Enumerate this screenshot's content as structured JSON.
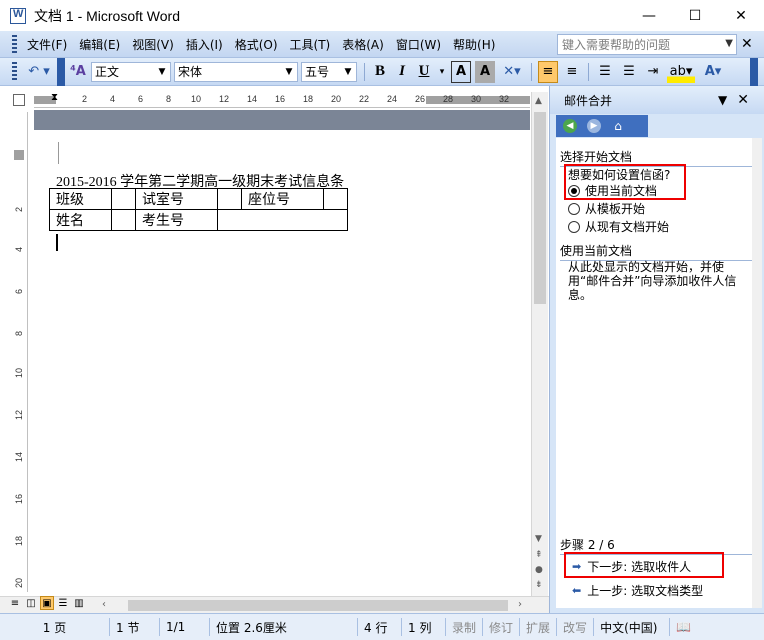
{
  "window": {
    "title": "文档 1 - Microsoft Word",
    "minimize": "—",
    "maximize": "☐",
    "close": "✕"
  },
  "menu": {
    "items": [
      "文件(F)",
      "编辑(E)",
      "视图(V)",
      "插入(I)",
      "格式(O)",
      "工具(T)",
      "表格(A)",
      "窗口(W)",
      "帮助(H)"
    ],
    "help_placeholder": "键入需要帮助的问题"
  },
  "toolbar": {
    "style": "正文",
    "font": "宋体",
    "size": "五号",
    "bold": "B",
    "italic": "I",
    "underline": "U",
    "font_color": "A"
  },
  "ruler": {
    "h_numbers": [
      "2",
      "4",
      "6",
      "8",
      "10",
      "12",
      "14",
      "16",
      "18",
      "20",
      "22",
      "24",
      "26",
      "28",
      "30",
      "32"
    ],
    "v_numbers": [
      "2",
      "4",
      "6",
      "8",
      "10",
      "12",
      "14",
      "16",
      "18",
      "20"
    ]
  },
  "document": {
    "title_line": "2015-2016 学年第二学期高一级期末考试信息条",
    "table": [
      [
        "班级",
        "",
        "试室号",
        "",
        "座位号",
        ""
      ],
      [
        "姓名",
        "",
        "考生号",
        ""
      ]
    ]
  },
  "taskpane": {
    "title": "邮件合并",
    "section1_title": "选择开始文档",
    "question": "想要如何设置信函?",
    "options": [
      "使用当前文档",
      "从模板开始",
      "从现有文档开始"
    ],
    "selected_option": "使用当前文档",
    "section2_title": "使用当前文档",
    "description": "从此处显示的文档开始，并使用“邮件合并”向导添加收件人信息。",
    "step_label": "步骤 2 / 6",
    "next_link": "下一步: 选取收件人",
    "prev_link": "上一步: 选取文档类型"
  },
  "status": {
    "page": "1 页",
    "section": "1 节",
    "pages": "1/1",
    "position": "位置 2.6厘米",
    "line": "4 行",
    "column": "1 列",
    "rec": "录制",
    "trk": "修订",
    "ext": "扩展",
    "ovr": "改写",
    "language": "中文(中国)"
  },
  "colors": {
    "accent": "#2b5aa6",
    "highlight": "#ffc96b",
    "annotation_box": "#e00000"
  }
}
